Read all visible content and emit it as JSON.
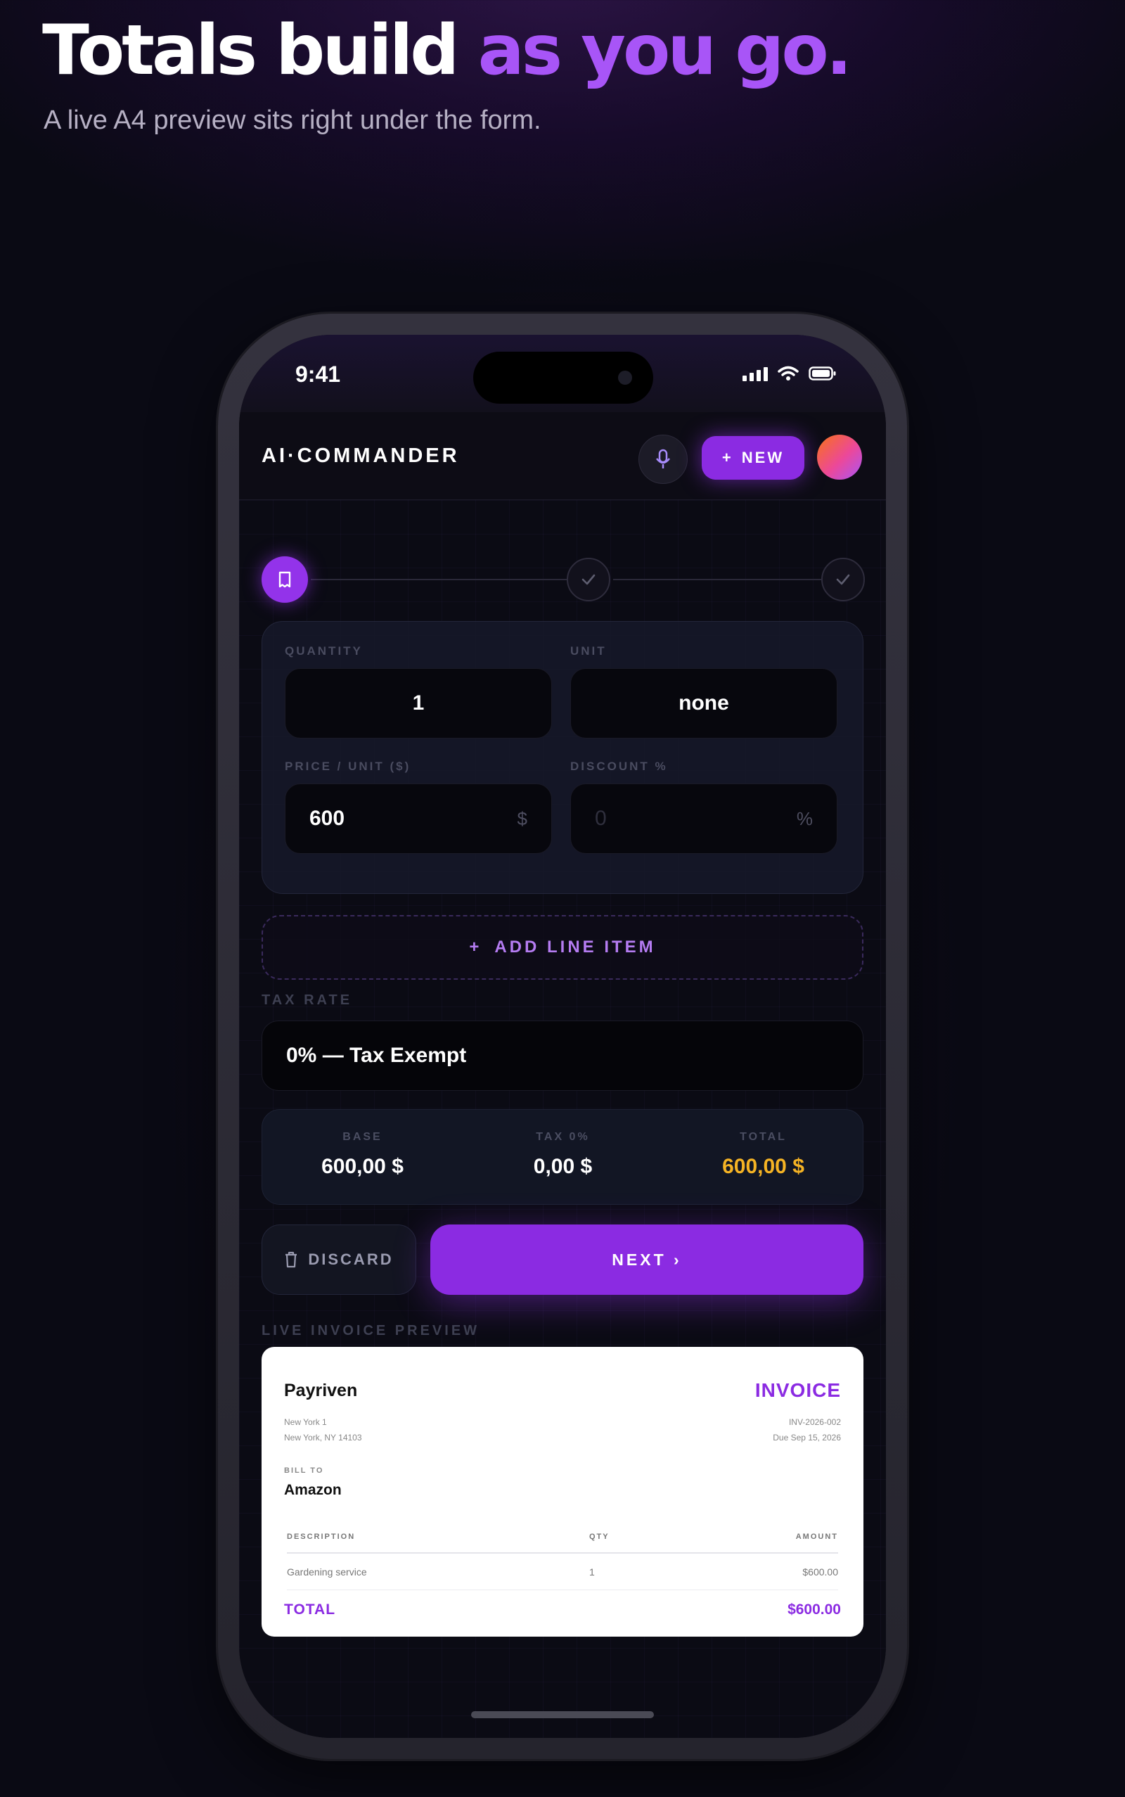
{
  "hero": {
    "title_plain": "Totals build",
    "title_accent": "as you go.",
    "subtitle": "A live A4 preview sits right under the form."
  },
  "status_bar": {
    "time": "9:41",
    "icons": [
      "signal-icon",
      "wifi-icon",
      "battery-icon"
    ]
  },
  "header": {
    "brand": "AI·COMMANDER",
    "new_label": "NEW",
    "new_icon": "plus-icon",
    "mic_icon": "mic-icon"
  },
  "stepper": {
    "steps": [
      "active",
      "done",
      "done"
    ]
  },
  "line_item": {
    "quantity_label": "QUANTITY",
    "quantity_value": "1",
    "unit_label": "UNIT",
    "unit_value": "none",
    "price_label": "PRICE / UNIT ($)",
    "price_value": "600",
    "price_suffix": "$",
    "discount_label": "DISCOUNT %",
    "discount_placeholder": "0",
    "discount_suffix": "%"
  },
  "add_line_item": "ADD LINE ITEM",
  "tax": {
    "label": "TAX RATE",
    "value": "0% — Tax Exempt"
  },
  "totals": {
    "base_label": "BASE",
    "base_value": "600,00 $",
    "tax_label": "TAX 0%",
    "tax_value": "0,00 $",
    "total_label": "TOTAL",
    "total_value": "600,00 $"
  },
  "actions": {
    "discard_label": "DISCARD",
    "next_label": "NEXT ›"
  },
  "preview": {
    "label": "LIVE INVOICE PREVIEW",
    "company": "Payriven",
    "address_line1": "New York 1",
    "address_line2": "New York, NY 14103",
    "title": "INVOICE",
    "number": "INV-2026-002",
    "due": "Due Sep 15, 2026",
    "bill_to_label": "BILL TO",
    "client": "Amazon",
    "columns": [
      "DESCRIPTION",
      "QTY",
      "AMOUNT"
    ],
    "rows": [
      {
        "description": "Gardening service",
        "qty": "1",
        "amount": "$600.00"
      }
    ],
    "total_label": "TOTAL",
    "total_value": "$600.00"
  },
  "colors": {
    "accent": "#8b2be2",
    "accent_light": "#a855f7",
    "gold": "#f5b324",
    "background": "#0a0a14"
  }
}
